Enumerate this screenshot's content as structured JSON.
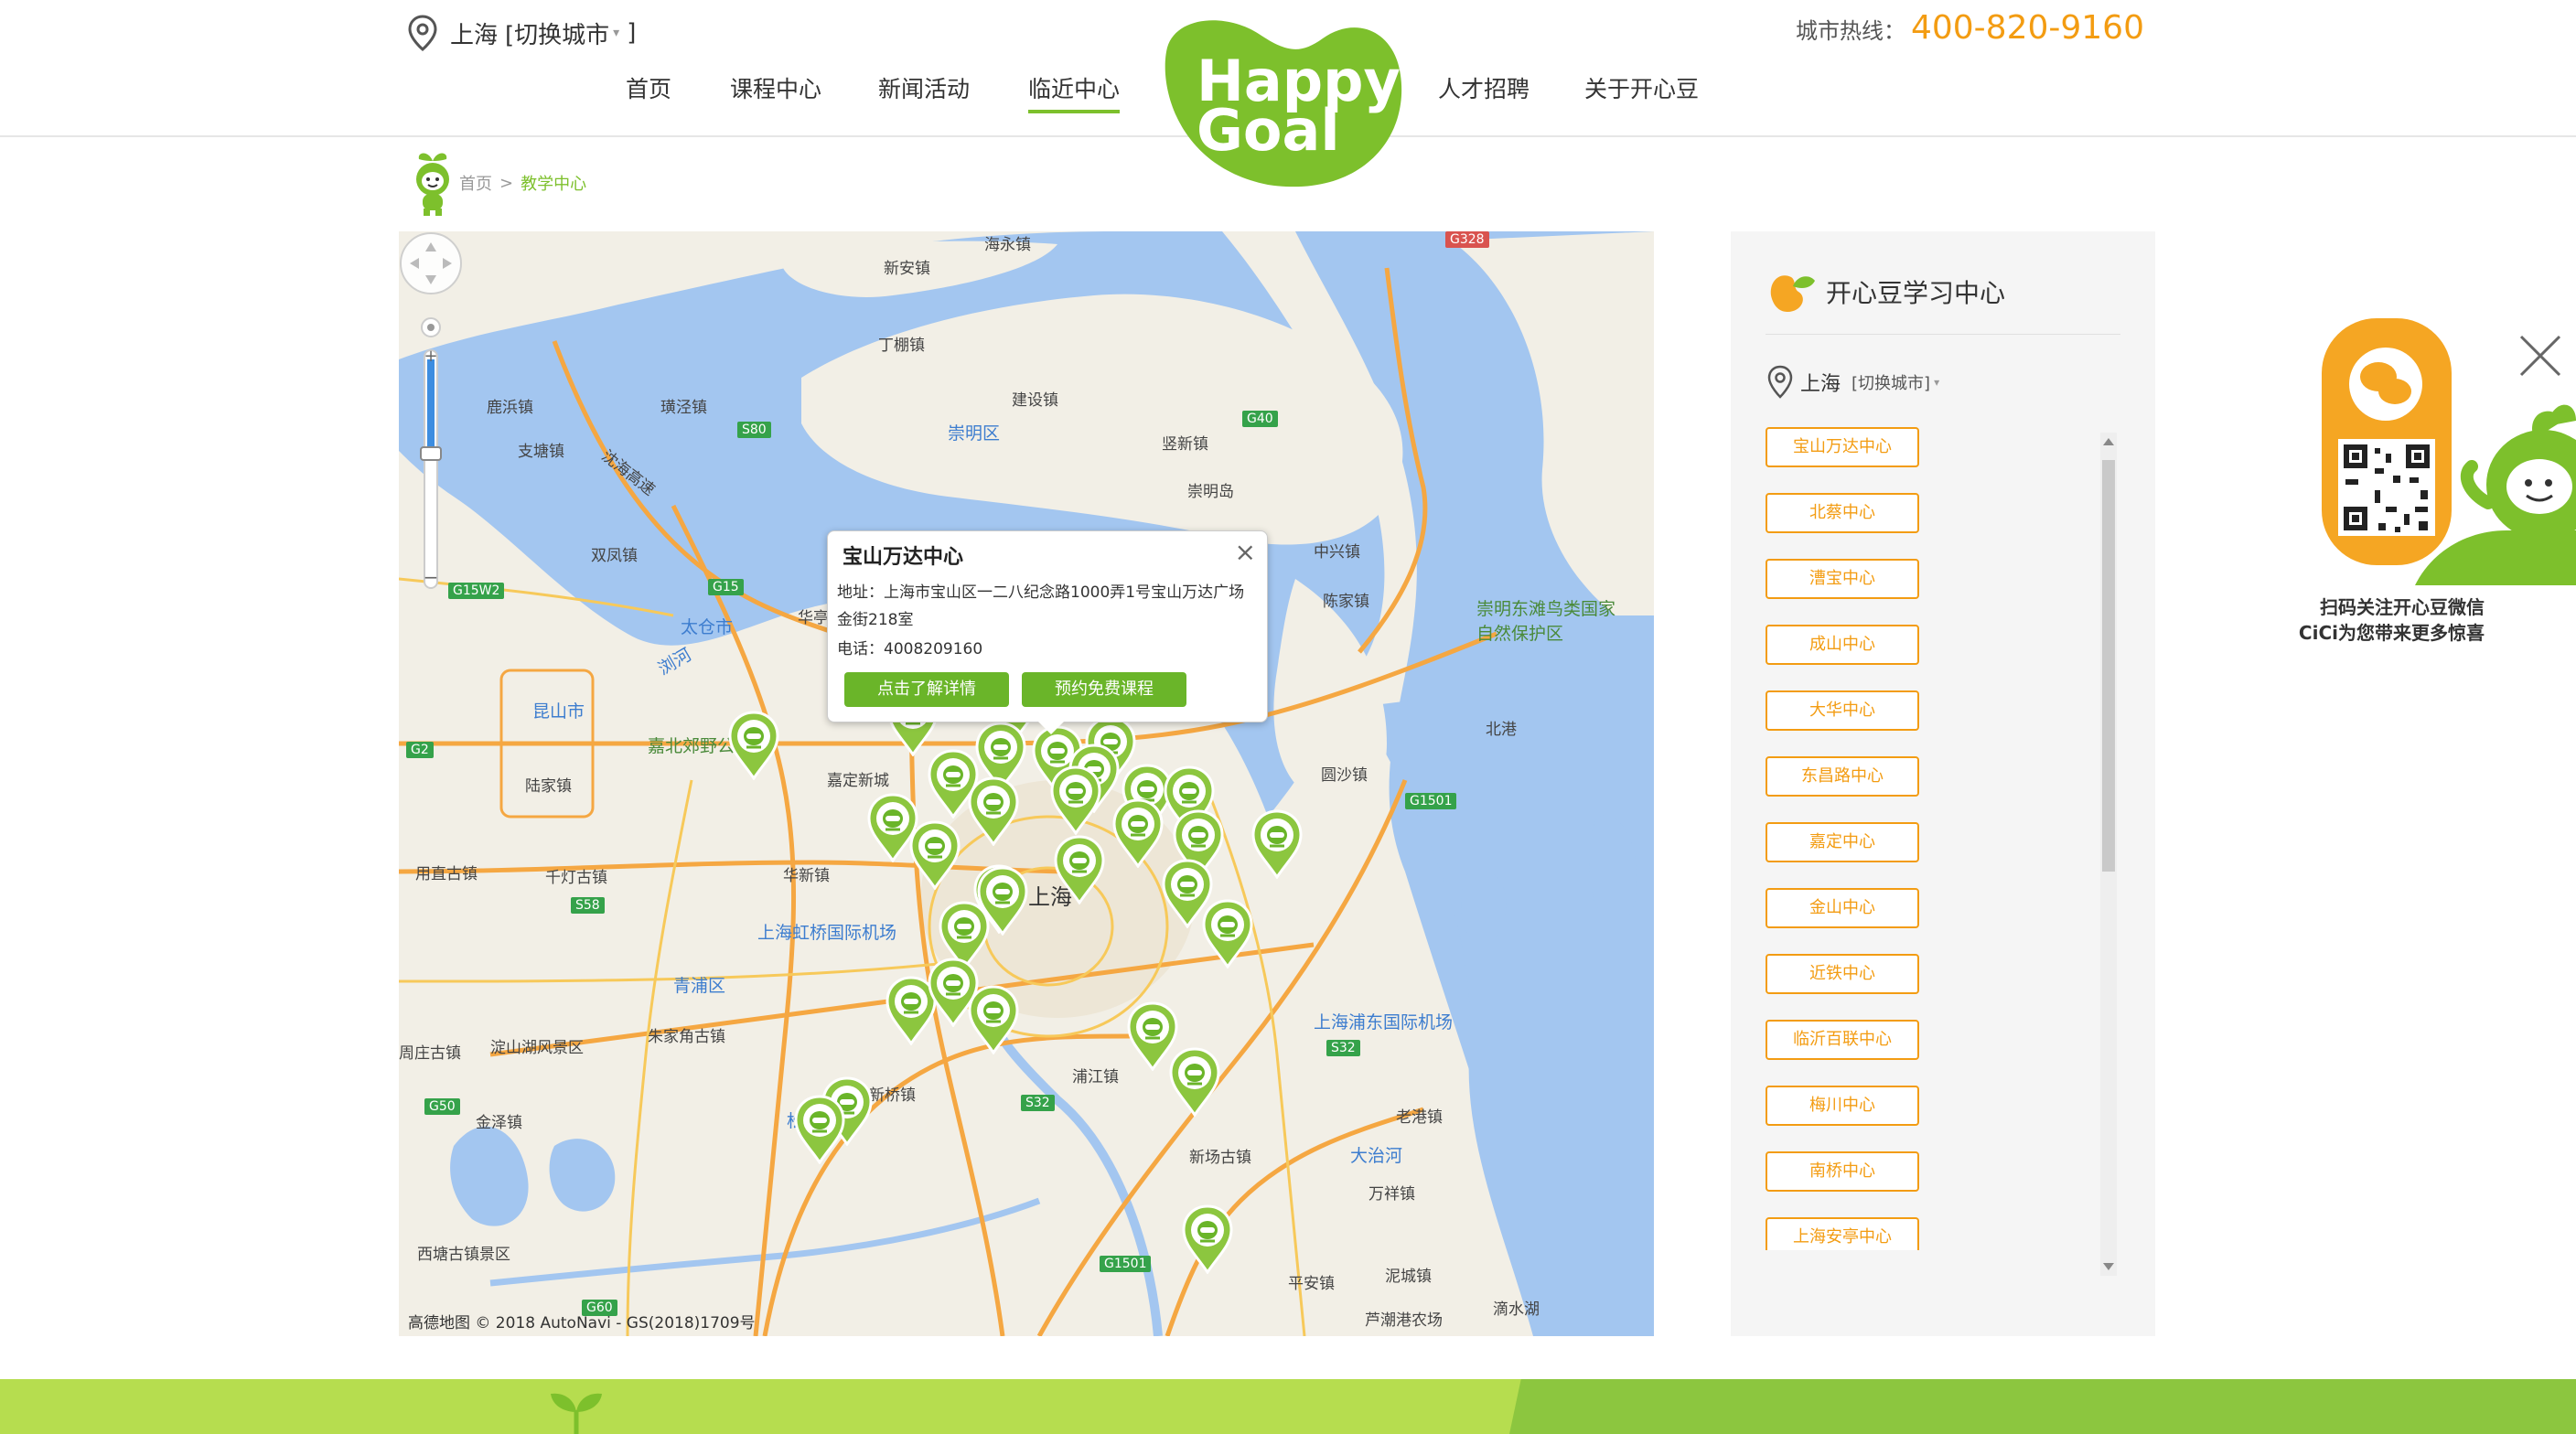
{
  "header": {
    "city": "上海",
    "switch_city": "[切换城市",
    "switch_city_end": "]",
    "nav": [
      "首页",
      "课程中心",
      "新闻活动",
      "临近中心",
      "人才招聘",
      "关于开心豆"
    ],
    "active_nav": "临近中心",
    "hotline_label": "城市热线：",
    "hotline_number": "400-820-9160",
    "logo_text_1": "Happy",
    "logo_text_2": "Goal"
  },
  "breadcrumb": {
    "home": "首页",
    "separator": ">",
    "current": "教学中心"
  },
  "map": {
    "labels": [
      "海永镇",
      "新安镇",
      "丁棚镇",
      "建设镇",
      "崇明区",
      "竖新镇",
      "崇明岛",
      "璜泾镇",
      "鹿浜镇",
      "支塘镇",
      "沈海高速",
      "双凤镇",
      "太仓市",
      "浏河",
      "华亭",
      "昆山市",
      "嘉北郊野公园",
      "嘉定新城",
      "陆家镇",
      "用直古镇",
      "千灯古镇",
      "华新镇",
      "上海",
      "上海虹桥国际机场",
      "青浦区",
      "淀山湖风景区",
      "朱家角古镇",
      "周庄古镇",
      "金泽镇",
      "松江区",
      "新桥镇",
      "浦江镇",
      "新场古镇",
      "上海浦东国际机场",
      "大治河",
      "万祥镇",
      "老港镇",
      "泥城镇",
      "平安镇",
      "芦潮港农场",
      "滴水湖",
      "西塘古镇景区",
      "中兴镇",
      "陈家镇",
      "崇明东滩鸟类国家自然保护区",
      "北港",
      "圆沙镇"
    ],
    "roads": [
      "G328",
      "S80",
      "G40",
      "G15W2",
      "G15",
      "G2",
      "G1501",
      "S58",
      "S32",
      "G50",
      "G60",
      "G1501",
      "S32"
    ],
    "copyright": "高德地图 © 2018 AutoNavi  - GS(2018)1709号",
    "popup": {
      "title": "宝山万达中心",
      "address": "地址：上海市宝山区一二八纪念路1000弄1号宝山万达广场金街218室",
      "phone": "电话：4008209160",
      "btn_details": "点击了解详情",
      "btn_book": "预约免费课程"
    }
  },
  "panel": {
    "title": "开心豆学习中心",
    "city": "上海",
    "switch_city": "[切换城市]",
    "centers": [
      "宝山万达中心",
      "北蔡中心",
      "漕宝中心",
      "成山中心",
      "大华中心",
      "东昌路中心",
      "嘉定中心",
      "金山中心",
      "近铁中心",
      "临沂百联中心",
      "梅川中心",
      "南桥中心",
      "上海安亭中心"
    ]
  },
  "wechat": {
    "caption_1": "扫码关注开心豆微信",
    "caption_2": "CiCi为您带来更多惊喜"
  },
  "colors": {
    "brand_green": "#7dc02c",
    "button_green": "#6ab529",
    "orange": "#f39c12",
    "water": "#a3c6f0",
    "land": "#f2efe6"
  }
}
